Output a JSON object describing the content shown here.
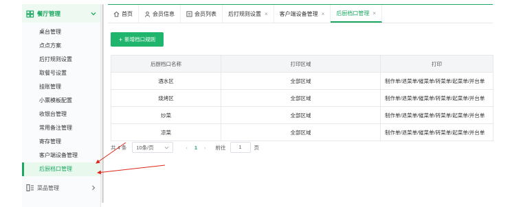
{
  "sidebar": {
    "group1": {
      "label": "餐厅管理",
      "icon": "store-icon"
    },
    "items": [
      {
        "label": "桌台管理"
      },
      {
        "label": "点点方案"
      },
      {
        "label": "后打规则设置"
      },
      {
        "label": "取餐号设置"
      },
      {
        "label": "挂账管理"
      },
      {
        "label": "小票模板配置"
      },
      {
        "label": "收银台管理"
      },
      {
        "label": "常用备注管理"
      },
      {
        "label": "寄存管理"
      },
      {
        "label": "客户端设备管理"
      },
      {
        "label": "后厨档口管理"
      }
    ],
    "active_index": 10,
    "group2": {
      "label": "菜品管理",
      "icon": "dish-icon"
    }
  },
  "tabs": [
    {
      "label": "首页",
      "icon": "home-icon",
      "closable": false
    },
    {
      "label": "会员信息",
      "icon": "user-icon",
      "closable": false
    },
    {
      "label": "会员列表",
      "icon": "list-icon",
      "closable": false
    },
    {
      "label": "后打规则设置",
      "closable": true
    },
    {
      "label": "客户端设备管理",
      "closable": true
    },
    {
      "label": "后厨档口管理",
      "closable": true,
      "active": true
    }
  ],
  "main": {
    "add_button": "新增档口规则",
    "table": {
      "headers": [
        "后厨档口名称",
        "打印区域",
        "打印"
      ],
      "rows": [
        [
          "酒水区",
          "全部区域",
          "制作单/退菜单/催菜单/转菜单/起菜单/并台单"
        ],
        [
          "烧烤区",
          "全部区域",
          "制作单/退菜单/催菜单/转菜单/起菜单/并台单"
        ],
        [
          "炒菜",
          "全部区域",
          "制作单/退菜单/催菜单/转菜单/起菜单/并台单"
        ],
        [
          "凉菜",
          "全部区域",
          "制作单/退菜单/催菜单/转菜单/起菜单/并台单"
        ]
      ]
    },
    "pagination": {
      "total": "共 4 条",
      "page_size": "10条/页",
      "current_page": "1",
      "goto_label": "前往",
      "goto_value": "1",
      "page_unit": "页"
    }
  },
  "colors": {
    "accent": "#1aa860",
    "annotation": "#e0251b"
  }
}
